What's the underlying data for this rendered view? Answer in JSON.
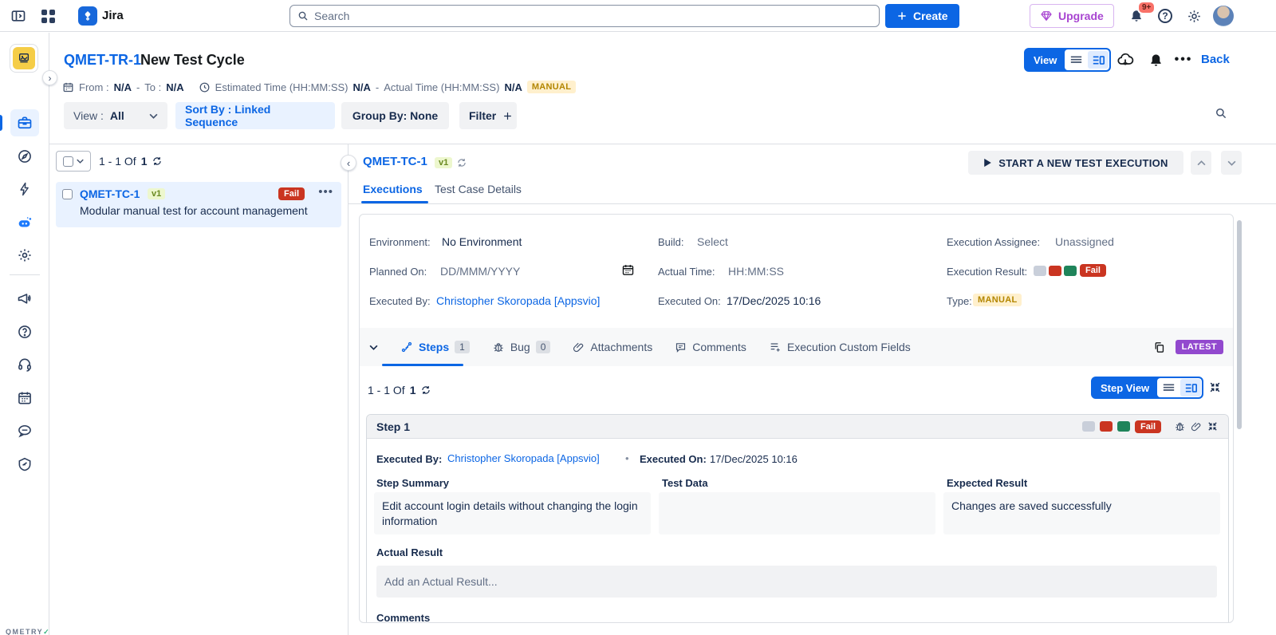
{
  "colors": {
    "accent_blue": "#0C66E4",
    "selected_blue_bg": "#E9F2FF",
    "fail_red": "#CA3521",
    "pass_green": "#1F845A",
    "neutral_gray": "#C9CFDA",
    "manual_badge_bg": "#FFF0CD",
    "manual_badge_text": "#B38600",
    "latest_badge": "#9249CE",
    "version_badge_bg": "#EDF7CE",
    "version_badge_text": "#6A8A22",
    "upgrade_purple": "#A845D1"
  },
  "icons": {
    "topbar": [
      "sidebar-toggle-icon",
      "app-grid-icon",
      "jira-logo",
      "search-icon",
      "plus-icon",
      "gem-icon",
      "bell-icon",
      "help-icon",
      "gear-icon",
      "avatar"
    ],
    "rail": [
      "project-logo",
      "briefcase-icon",
      "compass-icon",
      "bolt-icon",
      "bot-icon",
      "gear-icon",
      "megaphone-icon",
      "help-icon",
      "headset-icon",
      "calendar-icon",
      "chat-icon",
      "gauge-icon"
    ],
    "header": [
      "calendar-icon",
      "clock-icon",
      "list-view-icon",
      "detail-view-icon",
      "cloud-download-icon",
      "bell-icon",
      "more-icon"
    ],
    "section": [
      "steps-icon",
      "bug-icon",
      "paperclip-icon",
      "comment-icon",
      "custom-fields-icon",
      "copy-icon",
      "compress-icon",
      "refresh-icon",
      "play-icon"
    ]
  },
  "topbar": {
    "app_name": "Jira",
    "search_placeholder": "Search",
    "create_label": "Create",
    "upgrade_label": "Upgrade",
    "notifications_badge": "9+"
  },
  "sidebar": {
    "qmetry_logo": "QMETRY",
    "qmetry_check": "✓"
  },
  "cycle_header": {
    "key": "QMET-TR-1",
    "title": "New Test Cycle",
    "from_label": "From :",
    "from_value": "N/A",
    "sep1": "-",
    "to_label": "To :",
    "to_value": "N/A",
    "estimated_label": "Estimated Time (HH:MM:SS)",
    "estimated_value": "N/A",
    "sep2": "-",
    "actual_label": "Actual Time (HH:MM:SS)",
    "actual_value": "N/A",
    "manual_badge": "MANUAL",
    "view_button": "View",
    "back_link": "Back"
  },
  "toolbar": {
    "view_label": "View :",
    "view_value": "All",
    "sort_label": "Sort By : Linked Sequence",
    "group_label": "Group By: None",
    "filter_label": "Filter"
  },
  "test_list": {
    "range": "1 - 1 Of",
    "total": "1",
    "more": "•••",
    "item": {
      "key": "QMET-TC-1",
      "version": "v1",
      "status": "Fail",
      "summary": "Modular manual test for account management"
    }
  },
  "execution_panel": {
    "key": "QMET-TC-1",
    "version": "v1",
    "tabs": [
      {
        "label": "Executions"
      },
      {
        "label": "Test Case Details"
      }
    ],
    "start_button": "START A NEW TEST EXECUTION",
    "fields": {
      "environment_label": "Environment:",
      "environment_value": "No Environment",
      "build_label": "Build:",
      "build_value": "Select",
      "assignee_label": "Execution Assignee:",
      "assignee_value": "Unassigned",
      "planned_label": "Planned On:",
      "planned_value": "DD/MMM/YYYY",
      "actual_time_label": "Actual Time:",
      "actual_time_value": "HH:MM:SS",
      "result_label": "Execution Result:",
      "result_value": "Fail",
      "executed_by_label": "Executed By:",
      "executed_by_value": "Christopher Skoropada [Appsvio]",
      "executed_on_label": "Executed On:",
      "executed_on_value": "17/Dec/2025 10:16",
      "type_label": "Type:",
      "type_value": "MANUAL"
    },
    "section_tabs": [
      {
        "label": "Steps",
        "count": "1"
      },
      {
        "label": "Bug",
        "count": "0"
      },
      {
        "label": "Attachments"
      },
      {
        "label": "Comments"
      },
      {
        "label": "Execution Custom Fields"
      }
    ],
    "latest_badge": "LATEST",
    "steps_range": "1 - 1 Of",
    "steps_total": "1",
    "step_view_button": "Step View",
    "step": {
      "title": "Step 1",
      "result_badge": "Fail",
      "executed_by_label": "Executed By:",
      "executed_by_value": "Christopher Skoropada [Appsvio]",
      "dot": "•",
      "executed_on_label": "Executed On:",
      "executed_on_value": "17/Dec/2025 10:16",
      "summary_label": "Step Summary",
      "summary_value": "Edit account login details without changing the login information",
      "test_data_label": "Test Data",
      "test_data_value": "",
      "expected_label": "Expected Result",
      "expected_value": "Changes are saved successfully",
      "actual_result_label": "Actual Result",
      "actual_result_placeholder": "Add an Actual Result...",
      "comments_label": "Comments"
    }
  }
}
